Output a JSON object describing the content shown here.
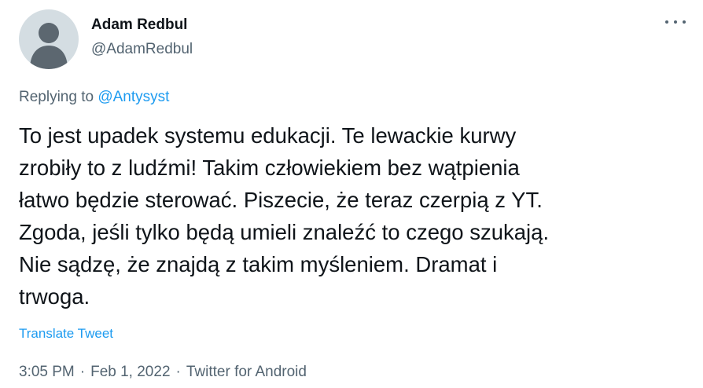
{
  "author": {
    "display_name": "Adam Redbul",
    "handle": "@AdamRedbul",
    "avatar_icon": "default-avatar-icon"
  },
  "more_icon": "more-options-icon",
  "reply": {
    "prefix": "Replying to ",
    "mention": "@Antysyst"
  },
  "tweet": {
    "text": "To jest upadek systemu edukacji. Te lewackie kurwy\nzrobiły to z ludźmi! Takim człowiekiem bez wątpienia\nłatwo będzie sterować. Piszecie, że teraz czerpią z YT.\nZgoda, jeśli tylko będą umieli znaleźć to czego szukają.\nNie sądzę, że znajdą z takim myśleniem. Dramat i\ntrwoga."
  },
  "translate_label": "Translate Tweet",
  "meta": {
    "time": "3:05 PM",
    "date": "Feb 1, 2022",
    "source": "Twitter for Android",
    "separator": "·"
  },
  "colors": {
    "text_primary": "#0f1419",
    "text_secondary": "#536471",
    "link": "#1d9bf0",
    "avatar_bg": "#d4dde2",
    "avatar_fg": "#5c6770"
  }
}
